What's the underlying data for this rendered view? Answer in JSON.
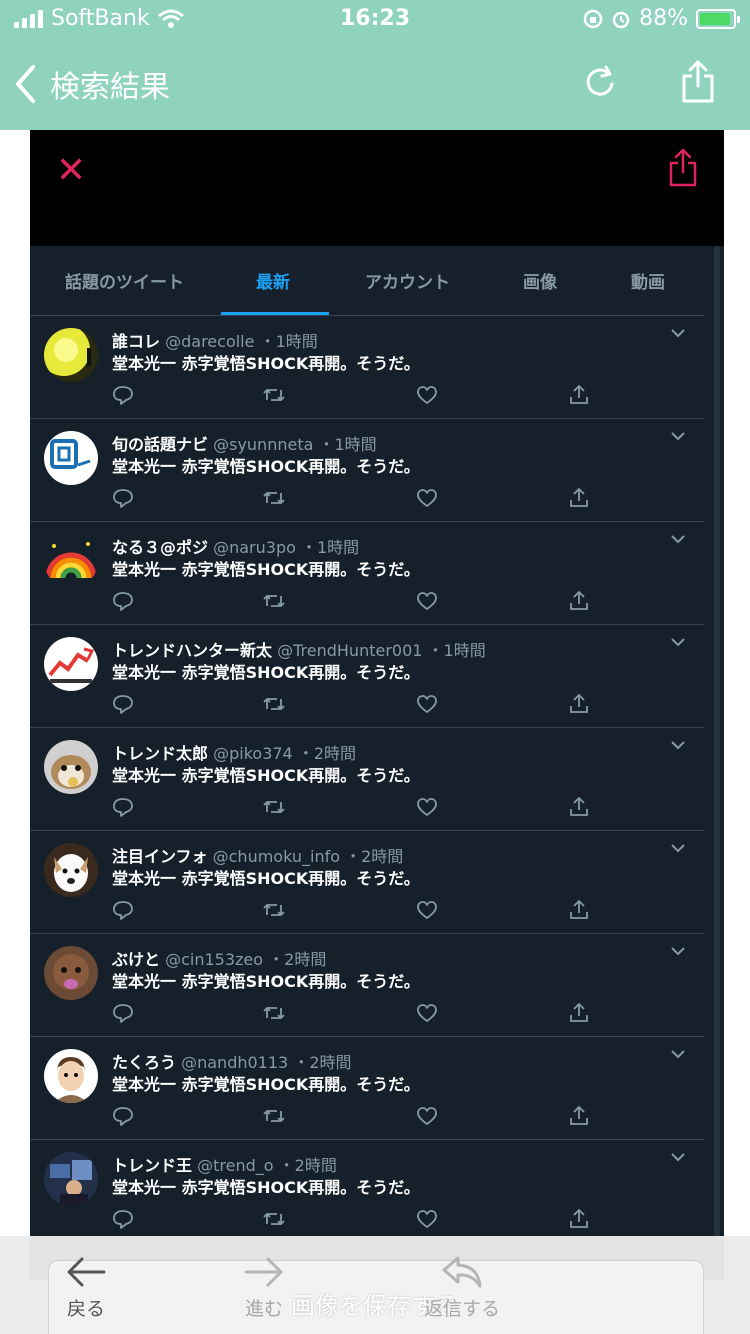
{
  "status_bar": {
    "carrier": "SoftBank",
    "time": "16:23",
    "battery": "88%"
  },
  "header": {
    "title": "検索結果"
  },
  "tabs": [
    {
      "label": "話題のツイート",
      "active": false
    },
    {
      "label": "最新",
      "active": true
    },
    {
      "label": "アカウント",
      "active": false
    },
    {
      "label": "画像",
      "active": false
    },
    {
      "label": "動画",
      "active": false
    }
  ],
  "tweets": [
    {
      "name": "誰コレ",
      "handle": "@darecolle",
      "time": "・1時間",
      "text": "堂本光一 赤字覚悟SHOCK再開。そうだ。"
    },
    {
      "name": "旬の話題ナビ",
      "handle": "@syunnneta",
      "time": "・1時間",
      "text": "堂本光一 赤字覚悟SHOCK再開。そうだ。"
    },
    {
      "name": "なる３@ポジ",
      "handle": "@naru3po",
      "time": "・1時間",
      "text": "堂本光一 赤字覚悟SHOCK再開。そうだ。"
    },
    {
      "name": "トレンドハンター新太",
      "handle": "@TrendHunter001",
      "time": "・1時間",
      "text": "堂本光一 赤字覚悟SHOCK再開。そうだ。"
    },
    {
      "name": "トレンド太郎",
      "handle": "@piko374",
      "time": "・2時間",
      "text": "堂本光一 赤字覚悟SHOCK再開。そうだ。"
    },
    {
      "name": "注目インフォ",
      "handle": "@chumoku_info",
      "time": "・2時間",
      "text": "堂本光一 赤字覚悟SHOCK再開。そうだ。"
    },
    {
      "name": "ぶけと",
      "handle": "@cin153zeo",
      "time": "・2時間",
      "text": "堂本光一 赤字覚悟SHOCK再開。そうだ。"
    },
    {
      "name": "たくろう",
      "handle": "@nandh0113",
      "time": "・2時間",
      "text": "堂本光一 赤字覚悟SHOCK再開。そうだ。"
    },
    {
      "name": "トレンド王",
      "handle": "@trend_o",
      "time": "・2時間",
      "text": "堂本光一 赤字覚悟SHOCK再開。そうだ。"
    }
  ],
  "bottom_bar": {
    "back_label": "戻る",
    "forward_label": "進む",
    "reply_label": "返信する",
    "save_label": "画像を保存する"
  }
}
